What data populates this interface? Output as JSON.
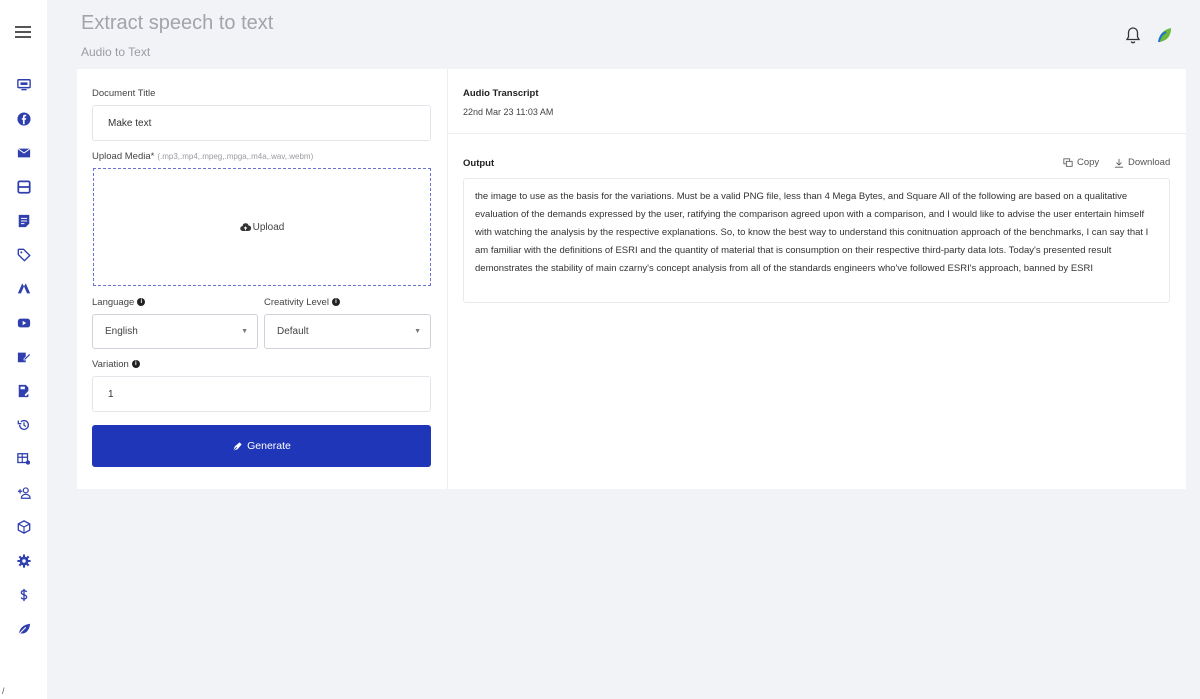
{
  "header": {
    "title": "Extract speech to text",
    "subtitle": "Audio to Text"
  },
  "sidebar": {
    "icons": [
      "monitor-icon",
      "facebook-icon",
      "mail-icon",
      "layout-icon",
      "document-icon",
      "tag-icon",
      "adwords-icon",
      "youtube-icon",
      "edit-icon",
      "file-edit-icon",
      "history-icon",
      "table-settings-icon",
      "add-user-icon",
      "package-icon",
      "gear-icon",
      "dollar-icon",
      "leaf-icon"
    ]
  },
  "form": {
    "doc_title_label": "Document Title",
    "doc_title_value": "Make text",
    "upload_label": "Upload Media*",
    "upload_hint": "(.mp3,.mp4,.mpeg,.mpga,.m4a,.wav,.webm)",
    "upload_text": "Upload",
    "language_label": "Language",
    "language_value": "English",
    "creativity_label": "Creativity Level",
    "creativity_value": "Default",
    "variation_label": "Variation",
    "variation_value": "1",
    "generate_label": "Generate"
  },
  "transcript": {
    "title": "Audio Transcript",
    "date": "22nd Mar 23 11:03 AM",
    "output_label": "Output",
    "copy_label": "Copy",
    "download_label": "Download",
    "output_text": "the image to use as the basis for the variations. Must be a valid PNG file, less than 4 Mega Bytes, and Square All of the following are based on a qualitative evaluation of the demands expressed by the user, ratifying the comparison agreed upon with a comparison, and I would like to advise the user entertain himself with watching the analysis by the respective explanations. So, to know the best way to understand this conitnuation approach of the benchmarks, I can say that I am familiar with the definitions of ESRI and the quantity of material that is consumption on their respective third-party data lots. Today's presented result demonstrates the stability of main czarny's concept analysis from all of the standards engineers who've followed ESRI's approach, banned by ESRI"
  },
  "footer": {
    "slash": "/"
  },
  "colors": {
    "accent": "#2036b8",
    "sidebar_icon": "#2f3fae",
    "leaf": "#6bb83a"
  }
}
